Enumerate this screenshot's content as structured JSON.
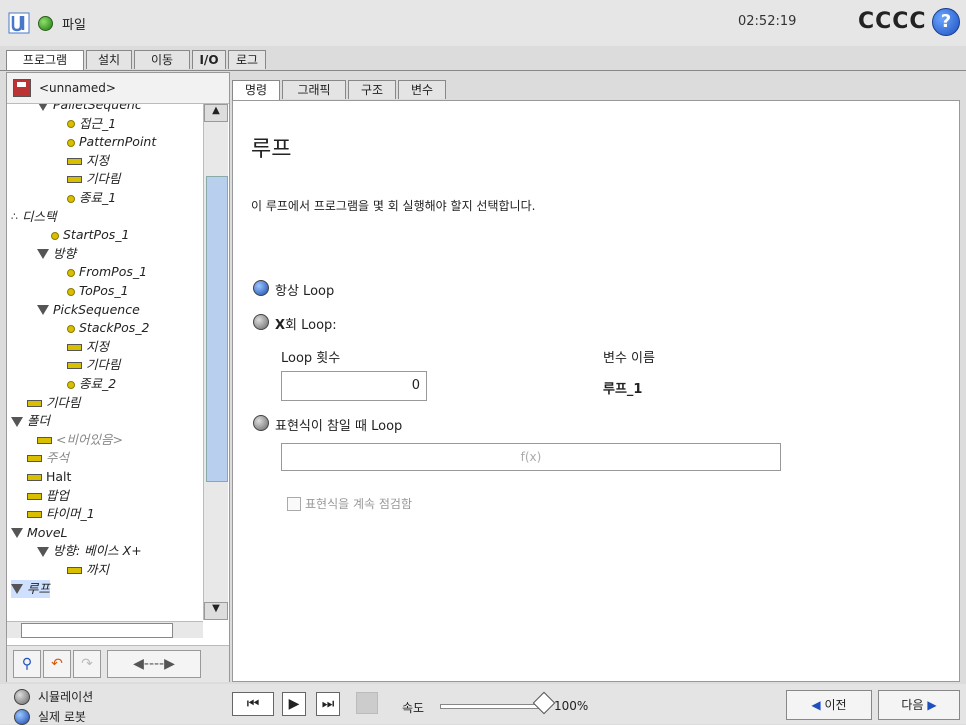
{
  "header": {
    "file_menu": "파일",
    "clock": "02:52:19",
    "robot_name": "CCCC",
    "help": "?"
  },
  "main_tabs": [
    "프로그램",
    "설치",
    "이동",
    "I/O",
    "로그"
  ],
  "program": {
    "name": "<unnamed>",
    "tree": [
      {
        "label": "PalletSequenc",
        "icon": "tri"
      },
      {
        "label": "접근_1",
        "icon": "wp"
      },
      {
        "label": "PatternPoint",
        "icon": "wp"
      },
      {
        "label": "지정",
        "icon": "bar"
      },
      {
        "label": "기다림",
        "icon": "bar"
      },
      {
        "label": "종료_1",
        "icon": "wp"
      },
      {
        "label": "디스택",
        "icon": "dots"
      },
      {
        "label": "StartPos_1",
        "icon": "wp"
      },
      {
        "label": "방향",
        "icon": "tri"
      },
      {
        "label": "FromPos_1",
        "icon": "wp"
      },
      {
        "label": "ToPos_1",
        "icon": "wp"
      },
      {
        "label": "PickSequence",
        "icon": "tri"
      },
      {
        "label": "StackPos_2",
        "icon": "wp"
      },
      {
        "label": "지정",
        "icon": "bar"
      },
      {
        "label": "기다림",
        "icon": "bar"
      },
      {
        "label": "종료_2",
        "icon": "wp"
      },
      {
        "label": "기다림",
        "icon": "bar"
      },
      {
        "label": "폴더",
        "icon": "tri"
      },
      {
        "label": "<비어있음>",
        "icon": "bar"
      },
      {
        "label": "주석",
        "icon": "bar"
      },
      {
        "label": "Halt",
        "icon": "bar"
      },
      {
        "label": "팝업",
        "icon": "bar"
      },
      {
        "label": "타이머_1",
        "icon": "bar"
      },
      {
        "label": "MoveL",
        "icon": "tri"
      },
      {
        "label": "방향: 베이스 X+",
        "icon": "tri"
      },
      {
        "label": "까지",
        "icon": "bar"
      },
      {
        "label": "루프",
        "icon": "tri"
      }
    ]
  },
  "sub_tabs": [
    "명령",
    "그래픽",
    "구조",
    "변수"
  ],
  "loop": {
    "title": "루프",
    "description": "이 루프에서 프로그램을 몇 회 실행해야 할지 선택합니다.",
    "option_always": "항상 Loop",
    "option_x_prefix": "X",
    "option_x": "회 Loop:",
    "count_label": "Loop 횟수",
    "var_label": "변수 이름",
    "count_value": "0",
    "var_value": "루프_1",
    "option_expr": "표현식이 참일 때 Loop",
    "expr_placeholder": "f(x)",
    "check_label": "표현식을 계속 점검함"
  },
  "footer": {
    "simulation": "시뮬레이션",
    "real_robot": "실제 로봇",
    "speed_label": "속도",
    "speed_value": "100%",
    "speed_fraction": 1.0,
    "prev": "이전",
    "next": "다음"
  }
}
